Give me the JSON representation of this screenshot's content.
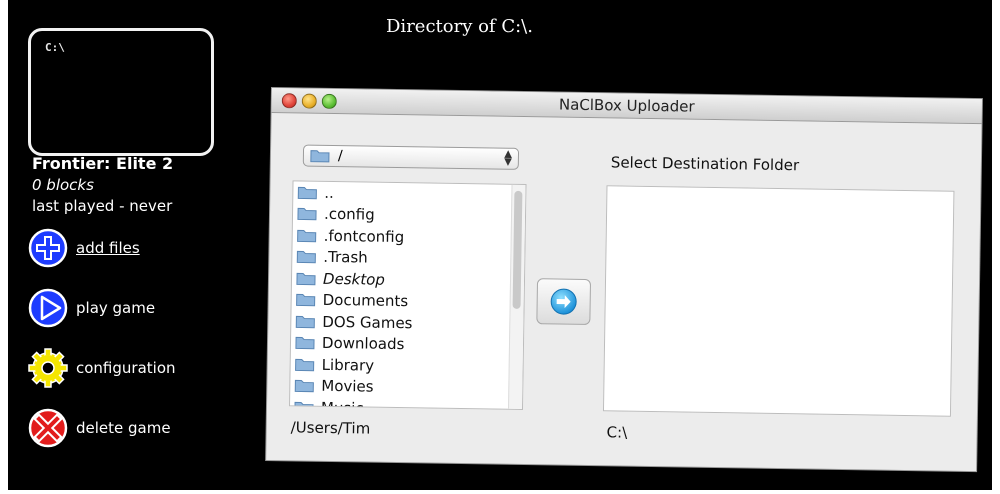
{
  "header": {
    "directory_title": "Directory of C:\\."
  },
  "game": {
    "screen_text": "C:\\",
    "title": "Frontier: Elite 2",
    "blocks": "0 blocks",
    "last_played": "last played - never"
  },
  "actions": [
    {
      "label": "add files",
      "icon": "plus-icon"
    },
    {
      "label": "play game",
      "icon": "play-icon"
    },
    {
      "label": "configuration",
      "icon": "gear-icon"
    },
    {
      "label": "delete game",
      "icon": "delete-x-icon"
    }
  ],
  "uploader": {
    "title": "NaClBox Uploader",
    "path_select": "/",
    "files": [
      {
        "name": "..",
        "italic": false
      },
      {
        "name": ".config",
        "italic": false
      },
      {
        "name": ".fontconfig",
        "italic": false
      },
      {
        "name": ".Trash",
        "italic": false
      },
      {
        "name": "Desktop",
        "italic": true
      },
      {
        "name": "Documents",
        "italic": false
      },
      {
        "name": "DOS Games",
        "italic": false
      },
      {
        "name": "Downloads",
        "italic": false
      },
      {
        "name": "Library",
        "italic": false
      },
      {
        "name": "Movies",
        "italic": false
      },
      {
        "name": "Music",
        "italic": false
      }
    ],
    "current_path": "/Users/Tim",
    "destination_label": "Select Destination Folder",
    "destination_path": "C:\\"
  },
  "colors": {
    "background": "#000000",
    "action_blue": "#1e3cff",
    "action_yellow": "#f5e600",
    "action_red": "#e21c1c",
    "folder_blue": "#8fb6dd"
  }
}
